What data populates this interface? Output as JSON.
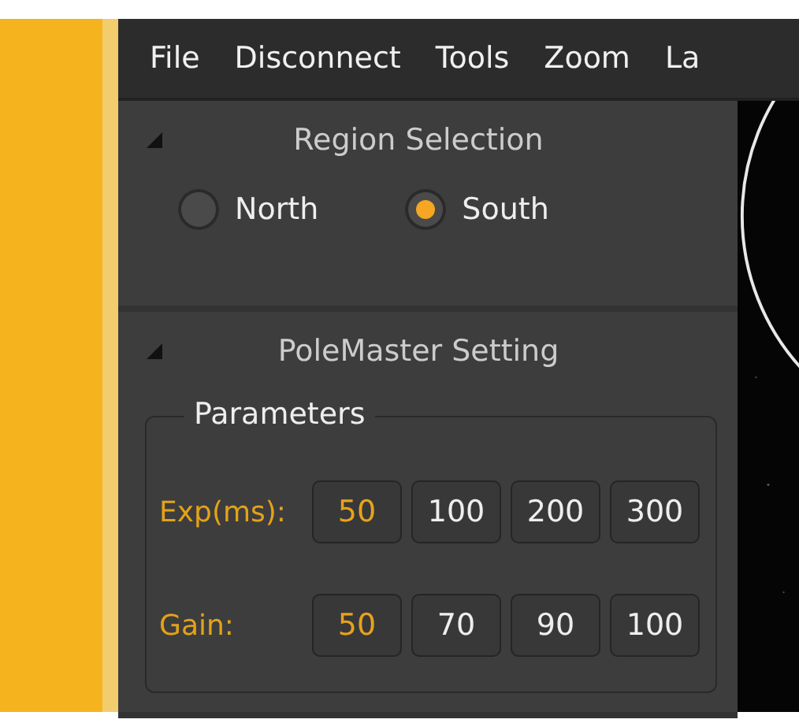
{
  "menu": [
    "File",
    "Disconnect",
    "Tools",
    "Zoom",
    "La"
  ],
  "sections": [
    {
      "title": "Region Selection",
      "expanded": true,
      "kind": "radios",
      "options": [
        {
          "label": "North",
          "selected": false
        },
        {
          "label": "South",
          "selected": true
        }
      ]
    },
    {
      "title": "PoleMaster Setting",
      "expanded": true,
      "kind": "params",
      "group": "Parameters",
      "rows": [
        {
          "label": "Exp(ms):",
          "buttons": [
            {
              "label": "50",
              "selected": true
            },
            {
              "label": "100",
              "selected": false
            },
            {
              "label": "200",
              "selected": false
            },
            {
              "label": "300",
              "selected": false
            }
          ]
        },
        {
          "label": "Gain:",
          "buttons": [
            {
              "label": "50",
              "selected": true
            },
            {
              "label": "70",
              "selected": false
            },
            {
              "label": "90",
              "selected": false
            },
            {
              "label": "100",
              "selected": false
            }
          ]
        }
      ]
    }
  ]
}
